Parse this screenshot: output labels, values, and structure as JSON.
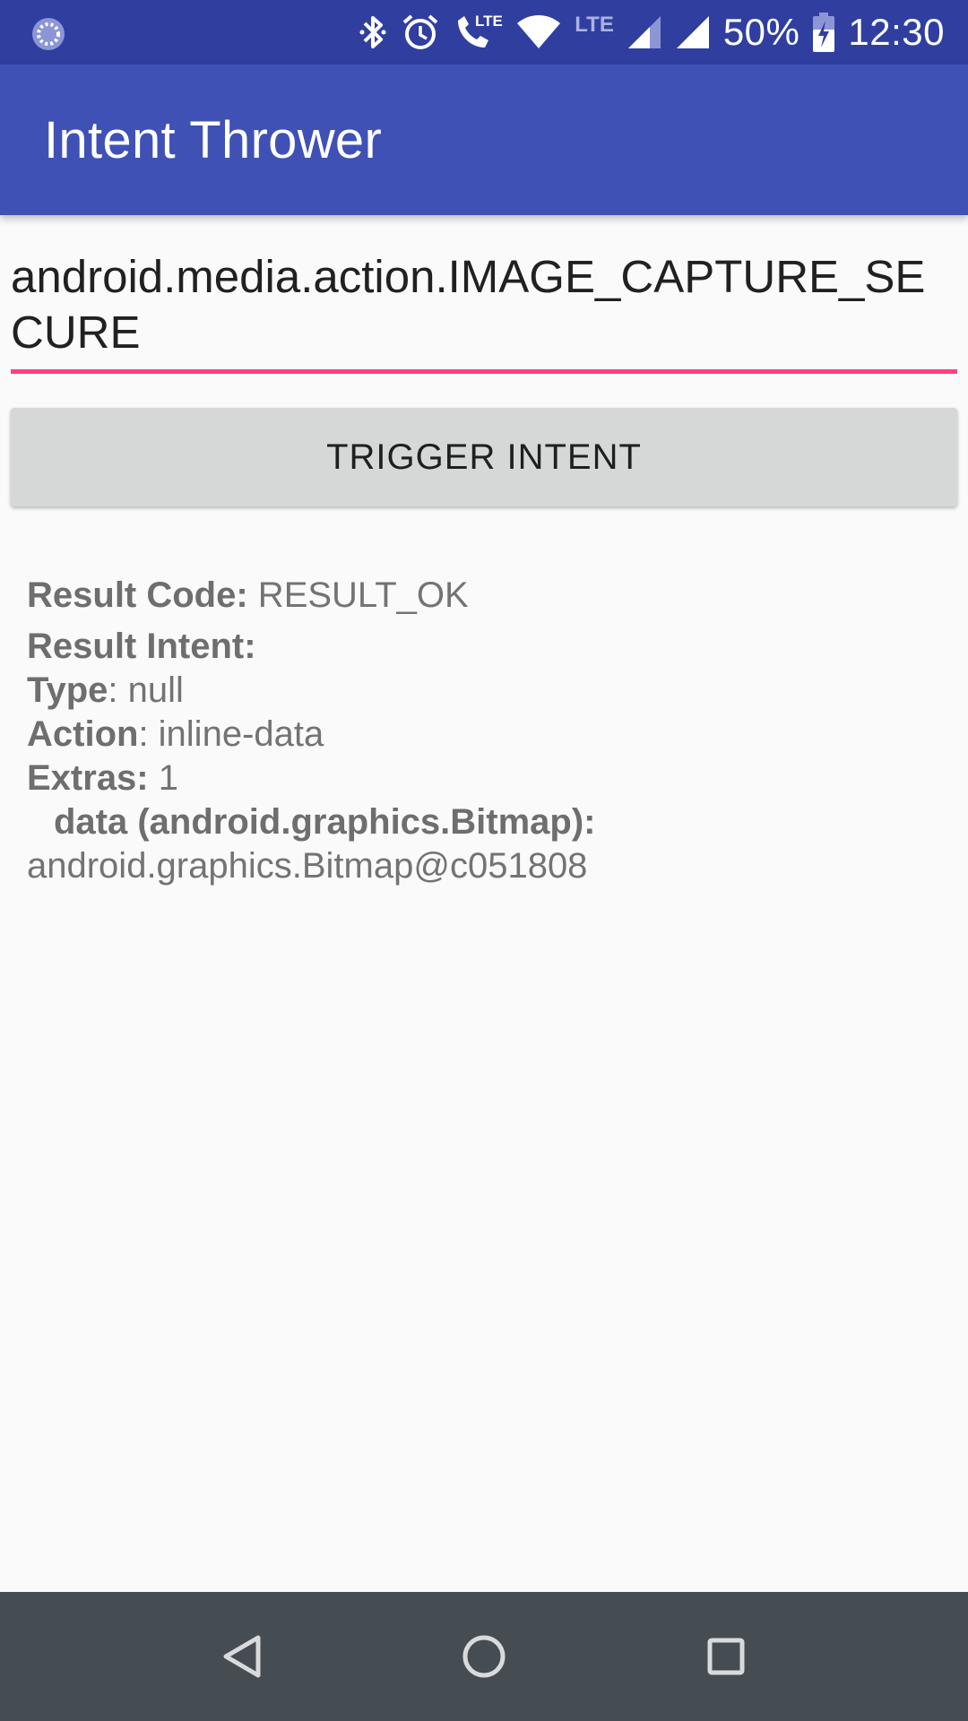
{
  "status_bar": {
    "lte_secondary": "LTE",
    "battery": "50%",
    "time": "12:30",
    "icons": [
      "loading-icon",
      "bluetooth-icon",
      "alarm-icon",
      "volte-call-icon",
      "wifi-icon",
      "signal-icon",
      "signal-icon-2",
      "battery-charging-icon"
    ]
  },
  "app_bar": {
    "title": "Intent Thrower"
  },
  "form": {
    "action_value": "android.media.action.IMAGE_CAPTURE_SECURE",
    "trigger_label": "TRIGGER INTENT"
  },
  "result": {
    "code_label": "Result Code:",
    "code_value": " RESULT_OK",
    "intent_label": "Result Intent:",
    "type_label": "Type",
    "type_value": ": null",
    "action_label": "Action",
    "action_value": ": inline-data",
    "extras_label": "Extras:",
    "extras_value": " 1",
    "extra_key": "data (android.graphics.Bitmap):",
    "extra_value": "android.graphics.Bitmap@c051808"
  },
  "nav_bar": {
    "back": "back-icon",
    "home": "home-icon",
    "recents": "recents-icon"
  },
  "colors": {
    "status_bar": "#303f9f",
    "app_bar": "#3f51b5",
    "accent": "#ff4081",
    "button": "#d6d7d7",
    "nav_bar": "#454c52",
    "background": "#fafafa"
  }
}
